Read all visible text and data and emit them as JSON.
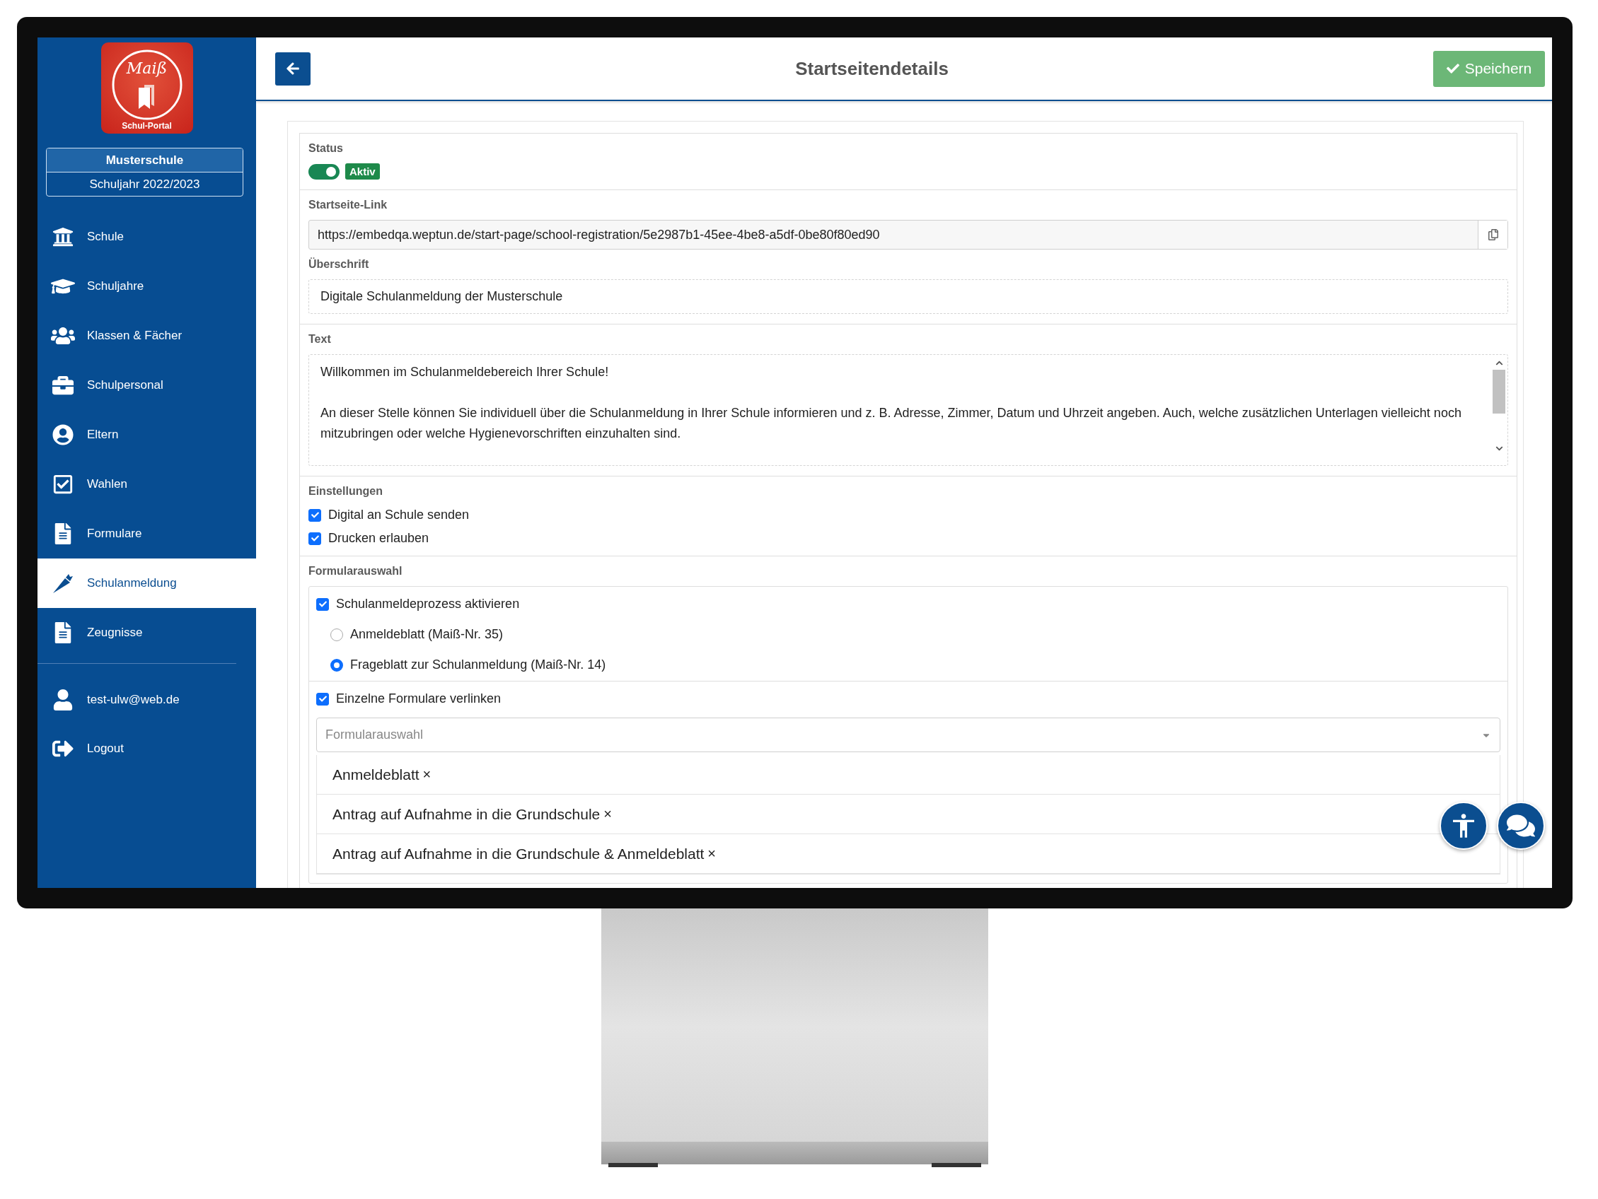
{
  "sidebar": {
    "logo": {
      "script": "Maiß",
      "caption": "Schul-Portal"
    },
    "school": "Musterschule",
    "school_year": "Schuljahr 2022/2023",
    "items": [
      {
        "label": "Schule",
        "selected": false
      },
      {
        "label": "Schuljahre",
        "selected": false
      },
      {
        "label": "Klassen & Fächer",
        "selected": false
      },
      {
        "label": "Schulpersonal",
        "selected": false
      },
      {
        "label": "Eltern",
        "selected": false
      },
      {
        "label": "Wahlen",
        "selected": false
      },
      {
        "label": "Formulare",
        "selected": false
      },
      {
        "label": "Schulanmeldung",
        "selected": true
      },
      {
        "label": "Zeugnisse",
        "selected": false
      }
    ],
    "account": [
      {
        "label": "test-ulw@web.de"
      },
      {
        "label": "Logout"
      }
    ]
  },
  "header": {
    "title": "Startseitendetails",
    "save_button": "Speichern"
  },
  "status": {
    "label": "Status",
    "on": true,
    "badge": "Aktiv"
  },
  "link": {
    "label": "Startseite-Link",
    "value": "https://embedqa.weptun.de/start-page/school-registration/5e2987b1-45ee-4be8-a5df-0be80f80ed90"
  },
  "heading": {
    "label": "Überschrift",
    "value": "Digitale Schulanmeldung der Musterschule"
  },
  "text": {
    "label": "Text",
    "paragraphs": [
      "Willkommen im Schulanmeldebereich Ihrer Schule!",
      "An dieser Stelle können Sie individuell über die Schulanmeldung in Ihrer Schule informieren und z. B. Adresse, Zimmer, Datum und Uhrzeit angeben. Auch, welche zusätzlichen Unterlagen vielleicht noch mitzubringen oder welche Hygienevorschriften einzuhalten sind."
    ]
  },
  "settings": {
    "label": "Einstellungen",
    "options": [
      {
        "label": "Digital an Schule senden",
        "checked": true
      },
      {
        "label": "Drucken erlauben",
        "checked": true
      }
    ]
  },
  "forms": {
    "label": "Formularauswahl",
    "process": {
      "label": "Schulanmeldeprozess aktivieren",
      "checked": true,
      "choices": [
        {
          "label": "Anmeldeblatt (Maiß-Nr. 35)",
          "selected": false
        },
        {
          "label": "Frageblatt zur Schulanmeldung (Maiß-Nr. 14)",
          "selected": true
        }
      ]
    },
    "link_forms": {
      "label": "Einzelne Formulare verlinken",
      "checked": true,
      "placeholder": "Formularauswahl",
      "selected_forms": [
        {
          "label": "Anmeldeblatt",
          "remove": "×"
        },
        {
          "label": "Antrag auf Aufnahme in die Grundschule",
          "remove": "×"
        },
        {
          "label": "Antrag auf Aufnahme in die Grundschule & Anmeldeblatt",
          "remove": "×"
        }
      ]
    }
  }
}
